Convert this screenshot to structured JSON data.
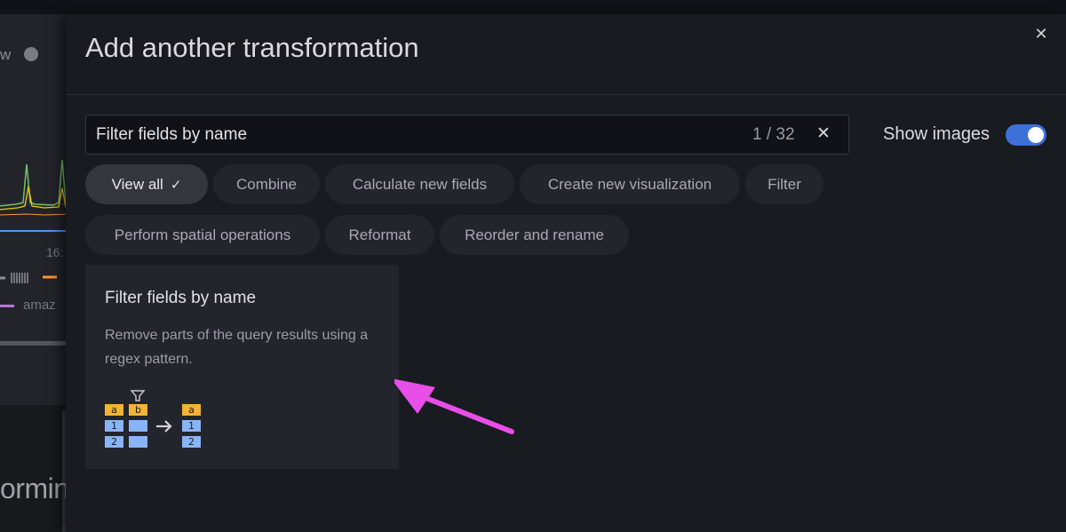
{
  "background": {
    "partial_text_top": "w",
    "axis_tick": "16:",
    "legend_text": "amaz",
    "big_text": "ormin"
  },
  "drawer": {
    "title": "Add another transformation",
    "close_glyph": "✕",
    "search": {
      "value": "Filter fields by name",
      "count": "1 / 32",
      "clear_glyph": "✕"
    },
    "show_images": {
      "label": "Show images",
      "enabled": true
    },
    "chips": [
      {
        "label": "View all",
        "active": true,
        "check": "✓"
      },
      {
        "label": "Combine"
      },
      {
        "label": "Calculate new fields"
      },
      {
        "label": "Create new visualization"
      },
      {
        "label": "Filter"
      },
      {
        "label": "Perform spatial operations"
      },
      {
        "label": "Reformat"
      },
      {
        "label": "Reorder and rename"
      }
    ],
    "card": {
      "title": "Filter fields by name",
      "description": "Remove parts of the query results using a regex pattern.",
      "image": {
        "headers": [
          "a",
          "b"
        ],
        "rows": [
          "1",
          "2"
        ],
        "result_header": "a",
        "result_rows": [
          "1",
          "2"
        ]
      }
    }
  },
  "colors": {
    "accent": "#3d71d9",
    "annotation_arrow": "#e84ee8",
    "header_cell": "#f2b337",
    "data_cell": "#8ab4f8"
  }
}
